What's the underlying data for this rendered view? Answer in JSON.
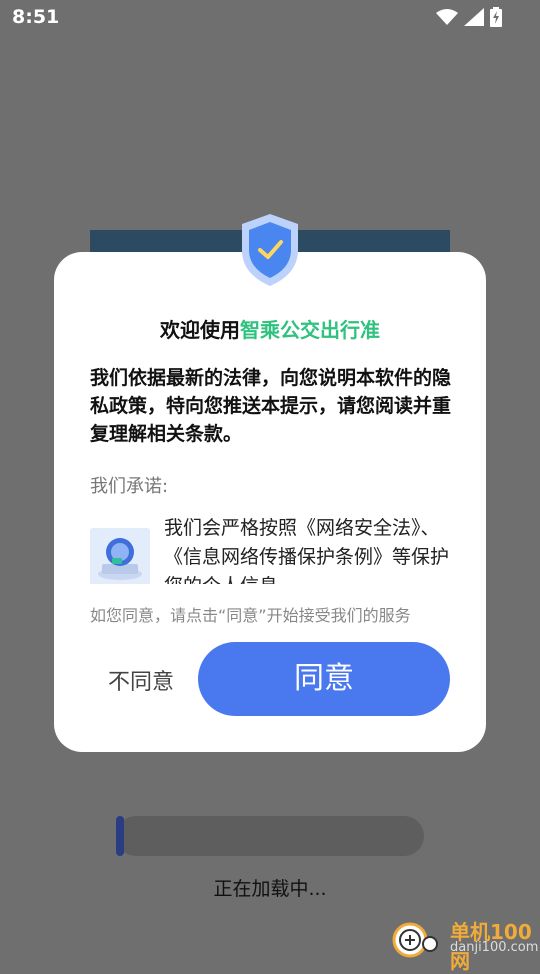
{
  "status_bar": {
    "time": "8:51",
    "icons": [
      "wifi-icon",
      "signal-icon",
      "battery-charging-icon"
    ]
  },
  "dialog": {
    "title_prefix": "欢迎使用",
    "title_app": "智乘公交出行准",
    "intro": "我们依据最新的法律，向您说明本软件的隐私政策，特向您推送本提示，请您阅读并重复理解相关条款。",
    "promise_label": "我们承诺:",
    "promise_text": "我们会严格按照《网络安全法》、《信息网络传播保护条例》等保护您的个人信息",
    "consent_hint": "如您同意，请点击“同意”开始接受我们的服务",
    "disagree_label": "不同意",
    "agree_label": "同意"
  },
  "loading": {
    "text": "正在加载中...",
    "progress": 0.03
  },
  "watermark": {
    "title": "单机100网",
    "url": "danji100.com"
  },
  "colors": {
    "accent_green": "#2ec27e",
    "agree_blue": "#4a78ee",
    "overlay": "#6f6f6f"
  }
}
